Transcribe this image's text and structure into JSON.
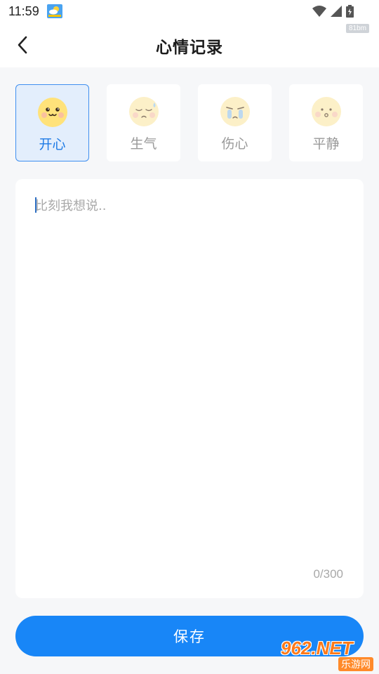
{
  "status_bar": {
    "time": "11:59"
  },
  "header": {
    "title": "心情记录",
    "watermark_small": "81bm"
  },
  "moods": [
    {
      "label": "开心",
      "icon": "happy-face-icon",
      "selected": true
    },
    {
      "label": "生气",
      "icon": "sweat-face-icon",
      "selected": false
    },
    {
      "label": "伤心",
      "icon": "crying-face-icon",
      "selected": false
    },
    {
      "label": "平静",
      "icon": "calm-face-icon",
      "selected": false
    }
  ],
  "note": {
    "placeholder": "比刻我想说..",
    "value": "",
    "char_count": "0/300"
  },
  "save_label": "保存",
  "watermark": {
    "top": "962.NET",
    "bottom": "乐游网"
  },
  "colors": {
    "accent": "#1886f7",
    "selected_bg": "#e3eefc",
    "selected_text": "#1e7be6",
    "face_selected": "#ffe27a",
    "face_inactive": "#fcf0c8"
  }
}
